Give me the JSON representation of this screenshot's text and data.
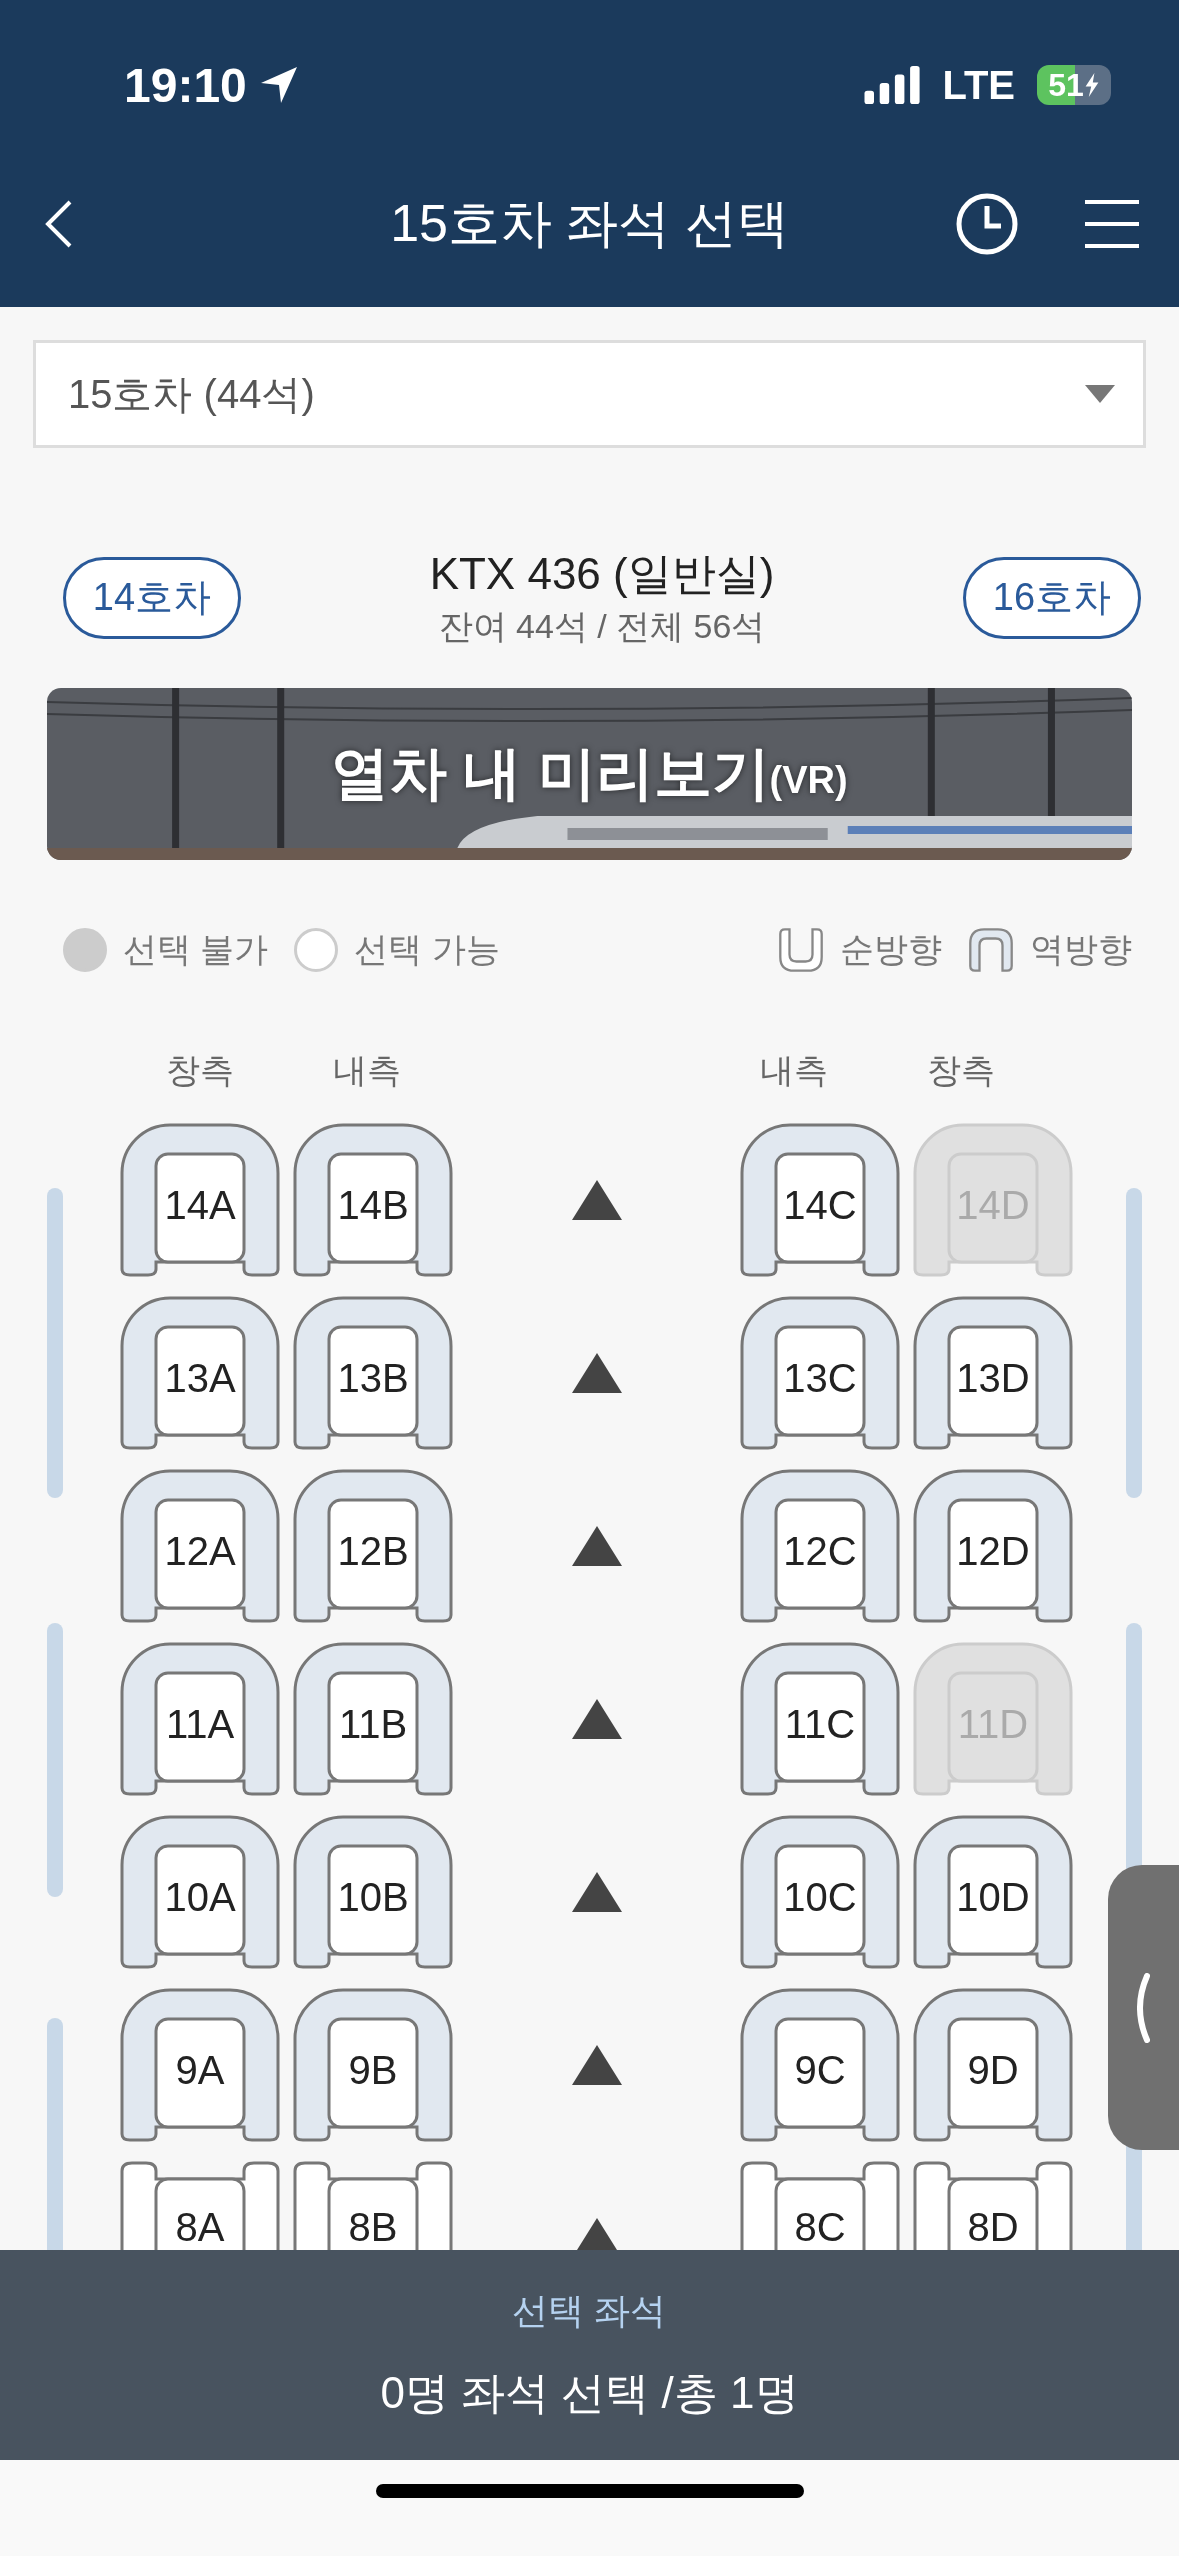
{
  "status_bar": {
    "time": "19:10",
    "network": "LTE",
    "battery": "51"
  },
  "header": {
    "title": "15호차 좌석 선택"
  },
  "car_select": {
    "value": "15호차 (44석)"
  },
  "car_nav": {
    "prev": "14호차",
    "next": "16호차",
    "train": "KTX 436 (일반실)",
    "seats_info": "잔여 44석 / 전체 56석"
  },
  "vr_banner": {
    "title": "열차 내 미리보기",
    "suffix": "(VR)"
  },
  "legend": [
    {
      "kind": "unavailable",
      "label": "선택 불가"
    },
    {
      "kind": "available",
      "label": "선택 가능"
    },
    {
      "kind": "forward",
      "label": "순방향"
    },
    {
      "kind": "reverse",
      "label": "역방향"
    }
  ],
  "columns": [
    "창측",
    "내측",
    "내측",
    "창측"
  ],
  "rows": [
    {
      "kind": "reverse",
      "seats": [
        {
          "label": "14A",
          "available": true
        },
        {
          "label": "14B",
          "available": true
        },
        {
          "label": "14C",
          "available": true
        },
        {
          "label": "14D",
          "available": false
        }
      ]
    },
    {
      "kind": "reverse",
      "seats": [
        {
          "label": "13A",
          "available": true
        },
        {
          "label": "13B",
          "available": true
        },
        {
          "label": "13C",
          "available": true
        },
        {
          "label": "13D",
          "available": true
        }
      ]
    },
    {
      "kind": "reverse",
      "seats": [
        {
          "label": "12A",
          "available": true
        },
        {
          "label": "12B",
          "available": true
        },
        {
          "label": "12C",
          "available": true
        },
        {
          "label": "12D",
          "available": true
        }
      ]
    },
    {
      "kind": "reverse",
      "seats": [
        {
          "label": "11A",
          "available": true
        },
        {
          "label": "11B",
          "available": true
        },
        {
          "label": "11C",
          "available": true
        },
        {
          "label": "11D",
          "available": false
        }
      ]
    },
    {
      "kind": "reverse",
      "seats": [
        {
          "label": "10A",
          "available": true
        },
        {
          "label": "10B",
          "available": true
        },
        {
          "label": "10C",
          "available": true
        },
        {
          "label": "10D",
          "available": true
        }
      ]
    },
    {
      "kind": "reverse",
      "seats": [
        {
          "label": "9A",
          "available": true
        },
        {
          "label": "9B",
          "available": true
        },
        {
          "label": "9C",
          "available": true
        },
        {
          "label": "9D",
          "available": true
        }
      ]
    },
    {
      "kind": "forward",
      "seats": [
        {
          "label": "8A",
          "available": true
        },
        {
          "label": "8B",
          "available": true
        },
        {
          "label": "8C",
          "available": true
        },
        {
          "label": "8D",
          "available": true
        }
      ]
    }
  ],
  "selection_panel": {
    "title": "선택 좌석",
    "summary": "0명 좌석 선택 /총 1명"
  }
}
